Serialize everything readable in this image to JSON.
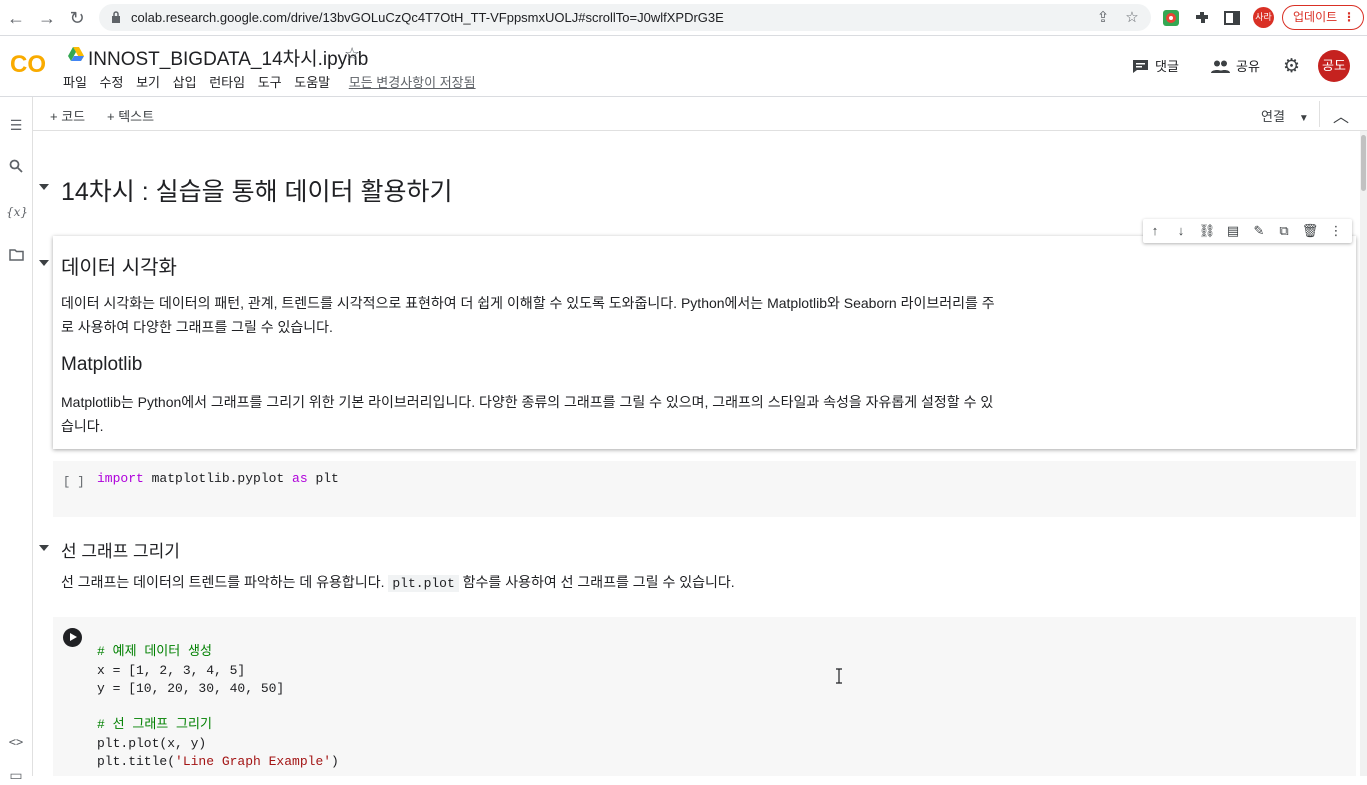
{
  "browser": {
    "url": "colab.research.google.com/drive/13bvGOLuCzQc4T7OtH_TT-VFppsmxUOLJ#scrollTo=J0wlfXPDrG3E",
    "profile_initials": "사라",
    "update_label": "업데이트"
  },
  "header": {
    "logo_text": "CO",
    "file_title": "INNOST_BIGDATA_14차시.ipynb",
    "menu": [
      "파일",
      "수정",
      "보기",
      "삽입",
      "런타임",
      "도구",
      "도움말"
    ],
    "saved_status": "모든 변경사항이 저장됨",
    "comment_label": "댓글",
    "share_label": "공유",
    "avatar_text": "공도"
  },
  "toolbar": {
    "add_code": "+ 코드",
    "add_text": "+ 텍스트",
    "connect": "연결"
  },
  "notebook": {
    "section_title": "14차시 : 실습을 통해 데이터 활용하기",
    "viz": {
      "title": "데이터 시각화",
      "para1_line1": "데이터 시각화는 데이터의 패턴, 관계, 트렌드를 시각적으로 표현하여 더 쉽게 이해할 수 있도록 도와줍니다. Python에서는 Matplotlib와 Seaborn 라이브러리를 주",
      "para1_line2": "로 사용하여 다양한 그래프를 그릴 수 있습니다.",
      "sub_title": "Matplotlib",
      "para2_line1": "Matplotlib는 Python에서 그래프를 그리기 위한 기본 라이브러리입니다. 다양한 종류의 그래프를 그릴 수 있으며, 그래프의 스타일과 속성을 자유롭게 설정할 수 있",
      "para2_line2": "습니다."
    },
    "import_cell": {
      "bracket": "[ ]",
      "kw_import": "import",
      "module": " matplotlib.pyplot ",
      "kw_as": "as",
      "alias": " plt"
    },
    "line_section": {
      "title": "선 그래프 그리기",
      "para_before": "선 그래프는 데이터의 트렌드를 파악하는 데 유용합니다.",
      "inline_code": "plt.plot",
      "para_after": "함수를 사용하여 선 그래프를 그릴 수 있습니다."
    },
    "code_cell": {
      "comment1": "# 예제 데이터 생성",
      "line_x": "x = [1, 2, 3, 4, 5]",
      "line_y": "y = [10, 20, 30, 40, 50]",
      "comment2": "# 선 그래프 그리기",
      "line_plot": "plt.plot(x, y)",
      "line_title_prefix": "plt.title(",
      "line_title_str": "'Line Graph Example'",
      "line_title_suffix": ")"
    }
  },
  "colors": {
    "accent_orange": "#f9ab00",
    "avatar_red": "#c5221f",
    "keyword": "#af00db",
    "comment": "#008000"
  }
}
